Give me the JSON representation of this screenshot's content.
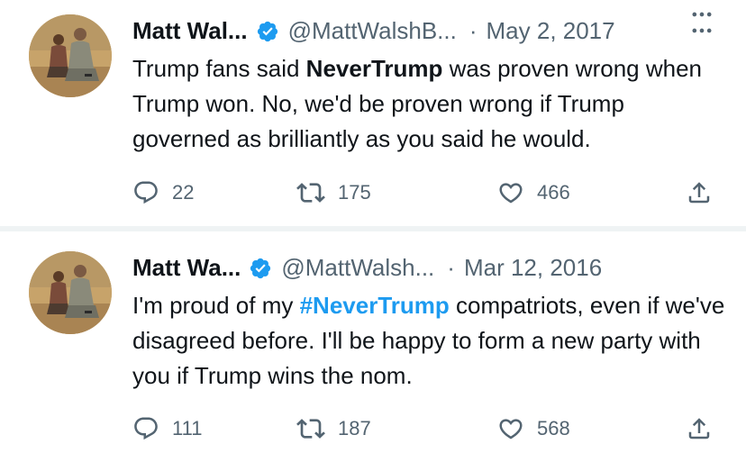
{
  "tweets": [
    {
      "author_name": "Matt Wal...",
      "handle": "@MattWalshB...",
      "separator": "·",
      "date": "May 2, 2017",
      "text_segments": [
        {
          "text": "Trump fans said ",
          "style": "normal"
        },
        {
          "text": "NeverTrump",
          "style": "bold"
        },
        {
          "text": " was proven wrong when Trump won. No, we'd be proven wrong if Trump governed as brilliantly as you said he would.",
          "style": "normal"
        }
      ],
      "replies": "22",
      "retweets": "175",
      "likes": "466"
    },
    {
      "author_name": "Matt Wa...",
      "handle": "@MattWalsh...",
      "separator": "·",
      "date": "Mar 12, 2016",
      "text_segments": [
        {
          "text": "I'm proud of my ",
          "style": "normal"
        },
        {
          "text": "#NeverTrump",
          "style": "hashtag"
        },
        {
          "text": " compatriots, even if we've disagreed before. I'll be happy to form a new party with you if Trump wins the nom.",
          "style": "normal"
        }
      ],
      "replies": "111",
      "retweets": "187",
      "likes": "568"
    }
  ],
  "colors": {
    "text": "#0f1419",
    "secondary": "#536471",
    "accent": "#1d9bf0",
    "divider": "#eff3f4"
  },
  "icons": {
    "verified": "verified-badge-icon",
    "more": "more-horizontal-icon",
    "reply": "reply-icon",
    "retweet": "retweet-icon",
    "like": "heart-icon",
    "share": "share-icon"
  }
}
